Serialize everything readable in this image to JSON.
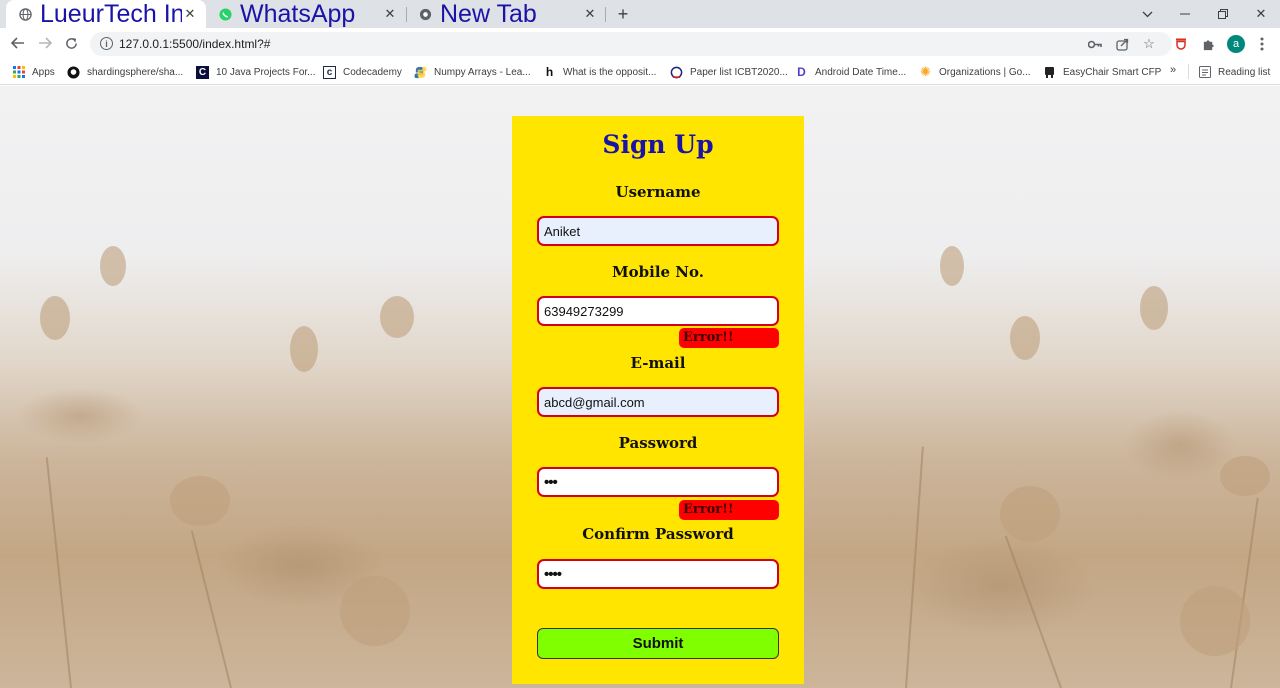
{
  "browser": {
    "tabs": [
      {
        "title": "LueurTech Internship Assignment",
        "icon": "globe-icon",
        "active": true
      },
      {
        "title": "WhatsApp",
        "icon": "whatsapp-icon",
        "active": false
      },
      {
        "title": "New Tab",
        "icon": "chrome-icon",
        "active": false
      }
    ],
    "url": "127.0.0.1:5500/index.html?#",
    "profile_initial": "a",
    "bookmarks": [
      {
        "label": "Apps",
        "icon": "apps-grid-icon"
      },
      {
        "label": "shardingsphere/sha...",
        "icon": "github-icon"
      },
      {
        "label": "10 Java Projects For...",
        "icon": "codebase-icon"
      },
      {
        "label": "Codecademy",
        "icon": "codecademy-icon"
      },
      {
        "label": "Numpy Arrays - Lea...",
        "icon": "python-icon"
      },
      {
        "label": "What is the opposit...",
        "icon": "hinative-icon"
      },
      {
        "label": "Paper list ICBT2020...",
        "icon": "conference-icon"
      },
      {
        "label": "Android Date Time...",
        "icon": "dribbble-icon"
      },
      {
        "label": "Organizations | Go...",
        "icon": "sun-icon"
      },
      {
        "label": "EasyChair Smart CFP",
        "icon": "easychair-icon"
      }
    ],
    "more_bookmarks": "»",
    "reading_list": "Reading list"
  },
  "form": {
    "title": "Sign Up",
    "username_label": "Username",
    "username_value": "Aniket",
    "mobile_label": "Mobile No.",
    "mobile_value": "63949273299",
    "mobile_error": "Error!!",
    "email_label": "E-mail",
    "email_value": "abcd@gmail.com",
    "password_label": "Password",
    "password_value": "•••",
    "password_error": "Error!!",
    "confirm_label": "Confirm Password",
    "confirm_value": "••••",
    "submit_label": "Submit"
  },
  "colors": {
    "card_bg": "#ffe500",
    "title_color": "#1a13a8",
    "field_border": "#d4001a",
    "error_bg": "#ff0000",
    "submit_bg": "#7fff00"
  }
}
